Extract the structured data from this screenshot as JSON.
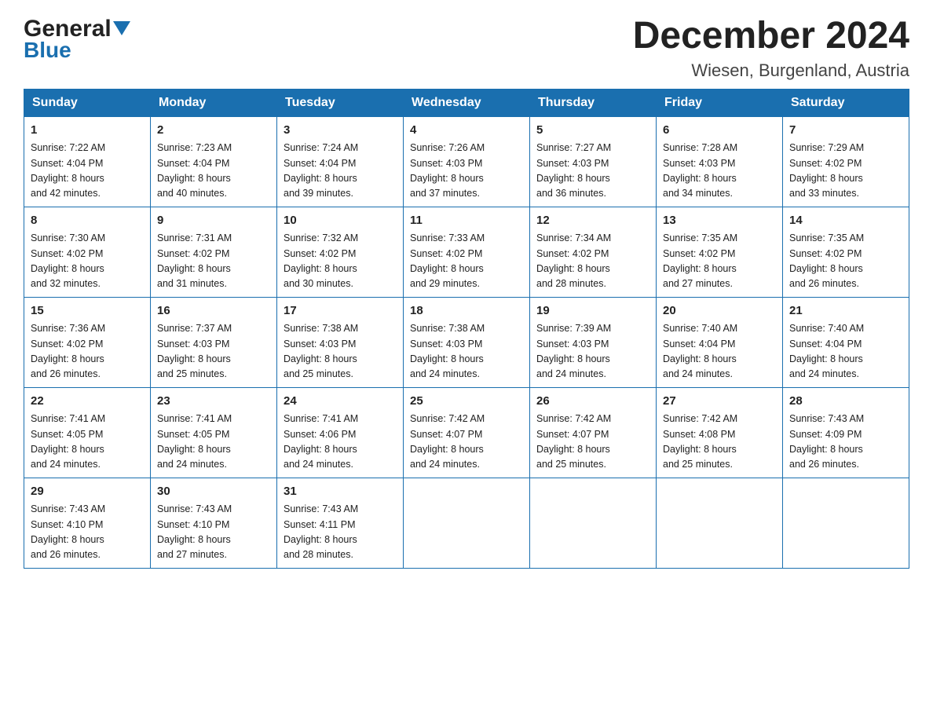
{
  "header": {
    "logo_general": "General",
    "logo_blue": "Blue",
    "title": "December 2024",
    "subtitle": "Wiesen, Burgenland, Austria"
  },
  "days_of_week": [
    "Sunday",
    "Monday",
    "Tuesday",
    "Wednesday",
    "Thursday",
    "Friday",
    "Saturday"
  ],
  "weeks": [
    [
      {
        "day": "1",
        "sunrise": "7:22 AM",
        "sunset": "4:04 PM",
        "daylight": "8 hours and 42 minutes."
      },
      {
        "day": "2",
        "sunrise": "7:23 AM",
        "sunset": "4:04 PM",
        "daylight": "8 hours and 40 minutes."
      },
      {
        "day": "3",
        "sunrise": "7:24 AM",
        "sunset": "4:04 PM",
        "daylight": "8 hours and 39 minutes."
      },
      {
        "day": "4",
        "sunrise": "7:26 AM",
        "sunset": "4:03 PM",
        "daylight": "8 hours and 37 minutes."
      },
      {
        "day": "5",
        "sunrise": "7:27 AM",
        "sunset": "4:03 PM",
        "daylight": "8 hours and 36 minutes."
      },
      {
        "day": "6",
        "sunrise": "7:28 AM",
        "sunset": "4:03 PM",
        "daylight": "8 hours and 34 minutes."
      },
      {
        "day": "7",
        "sunrise": "7:29 AM",
        "sunset": "4:02 PM",
        "daylight": "8 hours and 33 minutes."
      }
    ],
    [
      {
        "day": "8",
        "sunrise": "7:30 AM",
        "sunset": "4:02 PM",
        "daylight": "8 hours and 32 minutes."
      },
      {
        "day": "9",
        "sunrise": "7:31 AM",
        "sunset": "4:02 PM",
        "daylight": "8 hours and 31 minutes."
      },
      {
        "day": "10",
        "sunrise": "7:32 AM",
        "sunset": "4:02 PM",
        "daylight": "8 hours and 30 minutes."
      },
      {
        "day": "11",
        "sunrise": "7:33 AM",
        "sunset": "4:02 PM",
        "daylight": "8 hours and 29 minutes."
      },
      {
        "day": "12",
        "sunrise": "7:34 AM",
        "sunset": "4:02 PM",
        "daylight": "8 hours and 28 minutes."
      },
      {
        "day": "13",
        "sunrise": "7:35 AM",
        "sunset": "4:02 PM",
        "daylight": "8 hours and 27 minutes."
      },
      {
        "day": "14",
        "sunrise": "7:35 AM",
        "sunset": "4:02 PM",
        "daylight": "8 hours and 26 minutes."
      }
    ],
    [
      {
        "day": "15",
        "sunrise": "7:36 AM",
        "sunset": "4:02 PM",
        "daylight": "8 hours and 26 minutes."
      },
      {
        "day": "16",
        "sunrise": "7:37 AM",
        "sunset": "4:03 PM",
        "daylight": "8 hours and 25 minutes."
      },
      {
        "day": "17",
        "sunrise": "7:38 AM",
        "sunset": "4:03 PM",
        "daylight": "8 hours and 25 minutes."
      },
      {
        "day": "18",
        "sunrise": "7:38 AM",
        "sunset": "4:03 PM",
        "daylight": "8 hours and 24 minutes."
      },
      {
        "day": "19",
        "sunrise": "7:39 AM",
        "sunset": "4:03 PM",
        "daylight": "8 hours and 24 minutes."
      },
      {
        "day": "20",
        "sunrise": "7:40 AM",
        "sunset": "4:04 PM",
        "daylight": "8 hours and 24 minutes."
      },
      {
        "day": "21",
        "sunrise": "7:40 AM",
        "sunset": "4:04 PM",
        "daylight": "8 hours and 24 minutes."
      }
    ],
    [
      {
        "day": "22",
        "sunrise": "7:41 AM",
        "sunset": "4:05 PM",
        "daylight": "8 hours and 24 minutes."
      },
      {
        "day": "23",
        "sunrise": "7:41 AM",
        "sunset": "4:05 PM",
        "daylight": "8 hours and 24 minutes."
      },
      {
        "day": "24",
        "sunrise": "7:41 AM",
        "sunset": "4:06 PM",
        "daylight": "8 hours and 24 minutes."
      },
      {
        "day": "25",
        "sunrise": "7:42 AM",
        "sunset": "4:07 PM",
        "daylight": "8 hours and 24 minutes."
      },
      {
        "day": "26",
        "sunrise": "7:42 AM",
        "sunset": "4:07 PM",
        "daylight": "8 hours and 25 minutes."
      },
      {
        "day": "27",
        "sunrise": "7:42 AM",
        "sunset": "4:08 PM",
        "daylight": "8 hours and 25 minutes."
      },
      {
        "day": "28",
        "sunrise": "7:43 AM",
        "sunset": "4:09 PM",
        "daylight": "8 hours and 26 minutes."
      }
    ],
    [
      {
        "day": "29",
        "sunrise": "7:43 AM",
        "sunset": "4:10 PM",
        "daylight": "8 hours and 26 minutes."
      },
      {
        "day": "30",
        "sunrise": "7:43 AM",
        "sunset": "4:10 PM",
        "daylight": "8 hours and 27 minutes."
      },
      {
        "day": "31",
        "sunrise": "7:43 AM",
        "sunset": "4:11 PM",
        "daylight": "8 hours and 28 minutes."
      },
      null,
      null,
      null,
      null
    ]
  ],
  "labels": {
    "sunrise": "Sunrise:",
    "sunset": "Sunset:",
    "daylight": "Daylight:"
  }
}
